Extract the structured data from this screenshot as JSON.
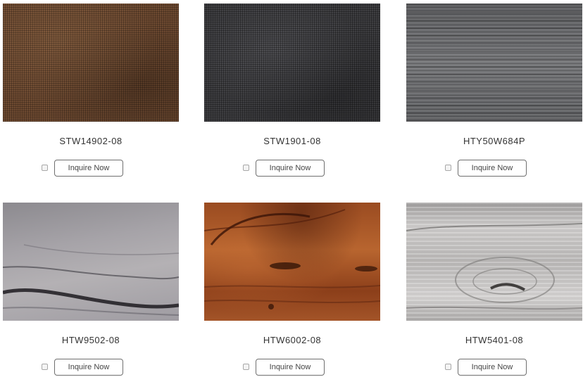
{
  "products": [
    {
      "code": "STW14902-08",
      "button_label": "Inquire Now",
      "swatch_icon": "fabric-brown-swatch"
    },
    {
      "code": "STW1901-08",
      "button_label": "Inquire Now",
      "swatch_icon": "fabric-charcoal-swatch"
    },
    {
      "code": "HTY50W684P",
      "button_label": "Inquire Now",
      "swatch_icon": "brushed-grey-swatch"
    },
    {
      "code": "HTW9502-08",
      "button_label": "Inquire Now",
      "swatch_icon": "grey-wood-swatch"
    },
    {
      "code": "HTW6002-08",
      "button_label": "Inquire Now",
      "swatch_icon": "rust-wood-swatch"
    },
    {
      "code": "HTW5401-08",
      "button_label": "Inquire Now",
      "swatch_icon": "whitewash-wood-swatch"
    }
  ]
}
